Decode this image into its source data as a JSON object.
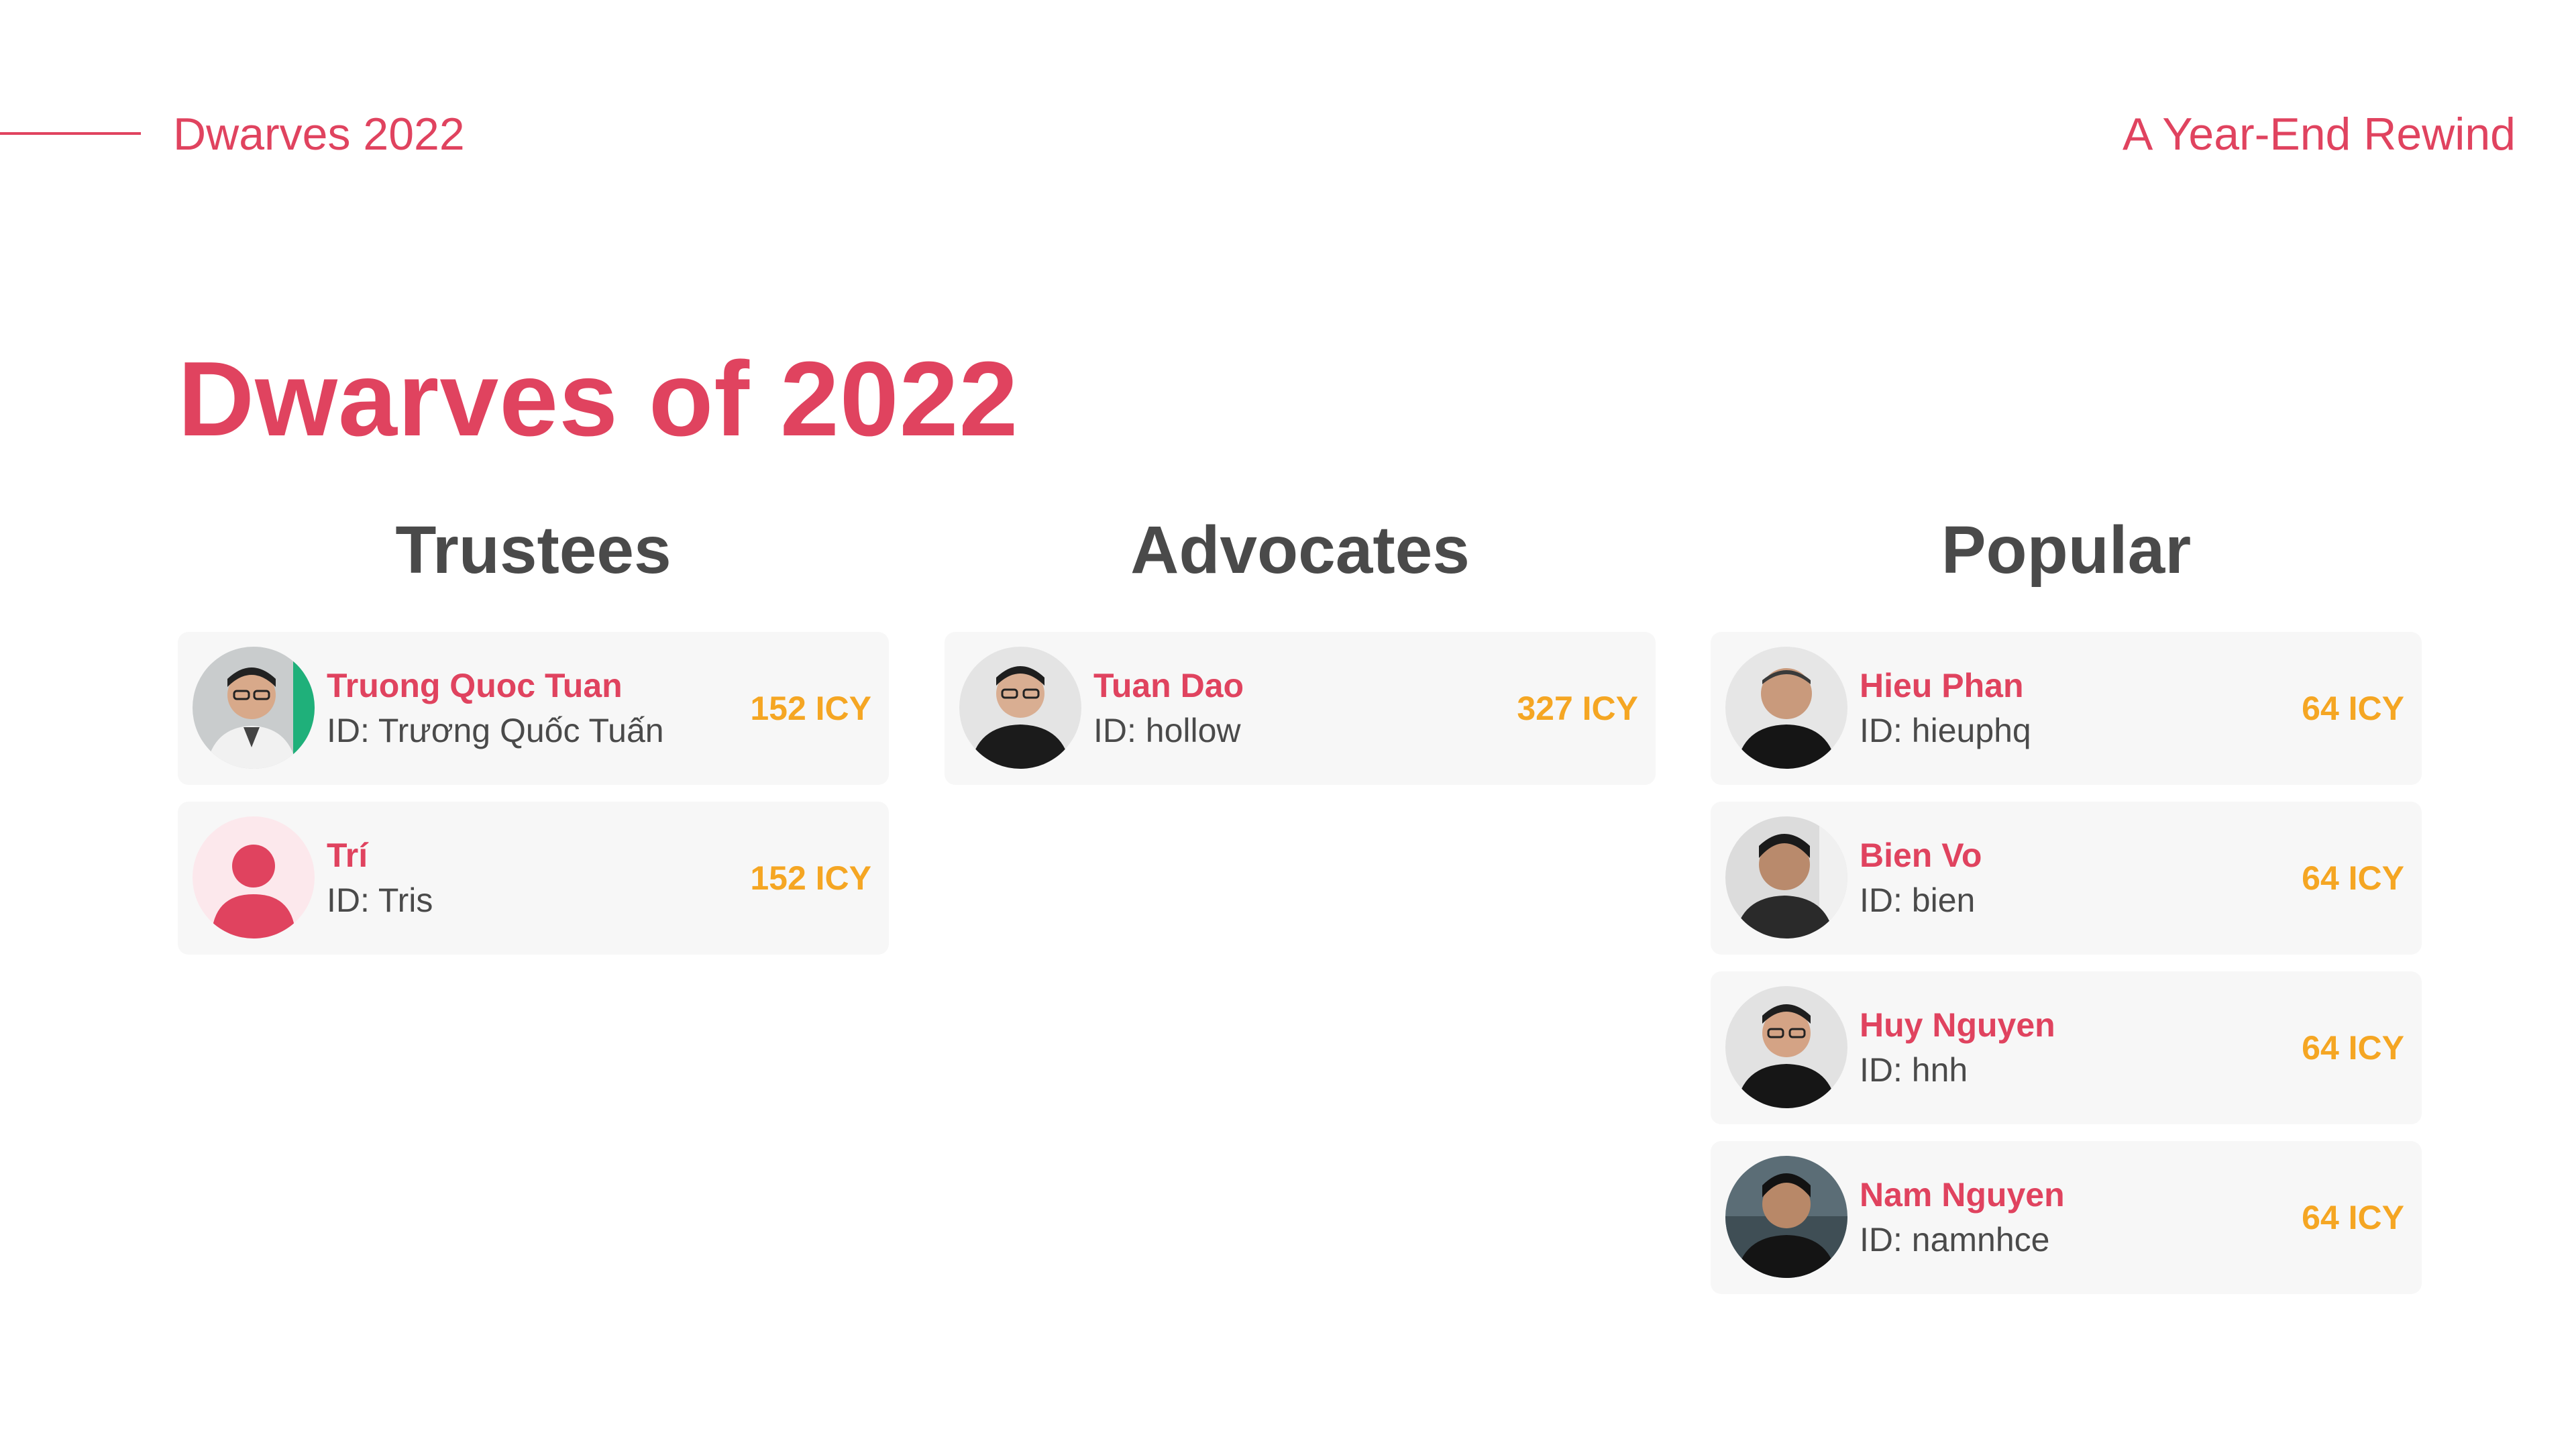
{
  "header": {
    "left_title": "Dwarves 2022",
    "right_title": "A Year-End Rewind"
  },
  "page_title": "Dwarves of 2022",
  "colors": {
    "accent": "#e0435f",
    "points": "#f5a623",
    "heading": "#4a4a4a",
    "card_bg": "#f7f7f7"
  },
  "columns": [
    {
      "heading": "Trustees",
      "members": [
        {
          "name": "Truong Quoc Tuan",
          "id": "ID: Trương Quốc Tuấn",
          "points": "152 ICY",
          "avatar": "photo-avatar"
        },
        {
          "name": "Trí",
          "id": "ID: Tris",
          "points": "152 ICY",
          "avatar": "default-user-icon"
        }
      ]
    },
    {
      "heading": "Advocates",
      "members": [
        {
          "name": "Tuan Dao",
          "id": "ID: hollow",
          "points": "327 ICY",
          "avatar": "photo-avatar"
        }
      ]
    },
    {
      "heading": "Popular",
      "members": [
        {
          "name": "Hieu Phan",
          "id": "ID: hieuphq",
          "points": "64 ICY",
          "avatar": "photo-avatar"
        },
        {
          "name": "Bien Vo",
          "id": "ID: bien",
          "points": "64 ICY",
          "avatar": "photo-avatar"
        },
        {
          "name": "Huy Nguyen",
          "id": "ID: hnh",
          "points": "64 ICY",
          "avatar": "photo-avatar"
        },
        {
          "name": "Nam Nguyen",
          "id": "ID: namnhce",
          "points": "64 ICY",
          "avatar": "photo-avatar"
        }
      ]
    }
  ]
}
